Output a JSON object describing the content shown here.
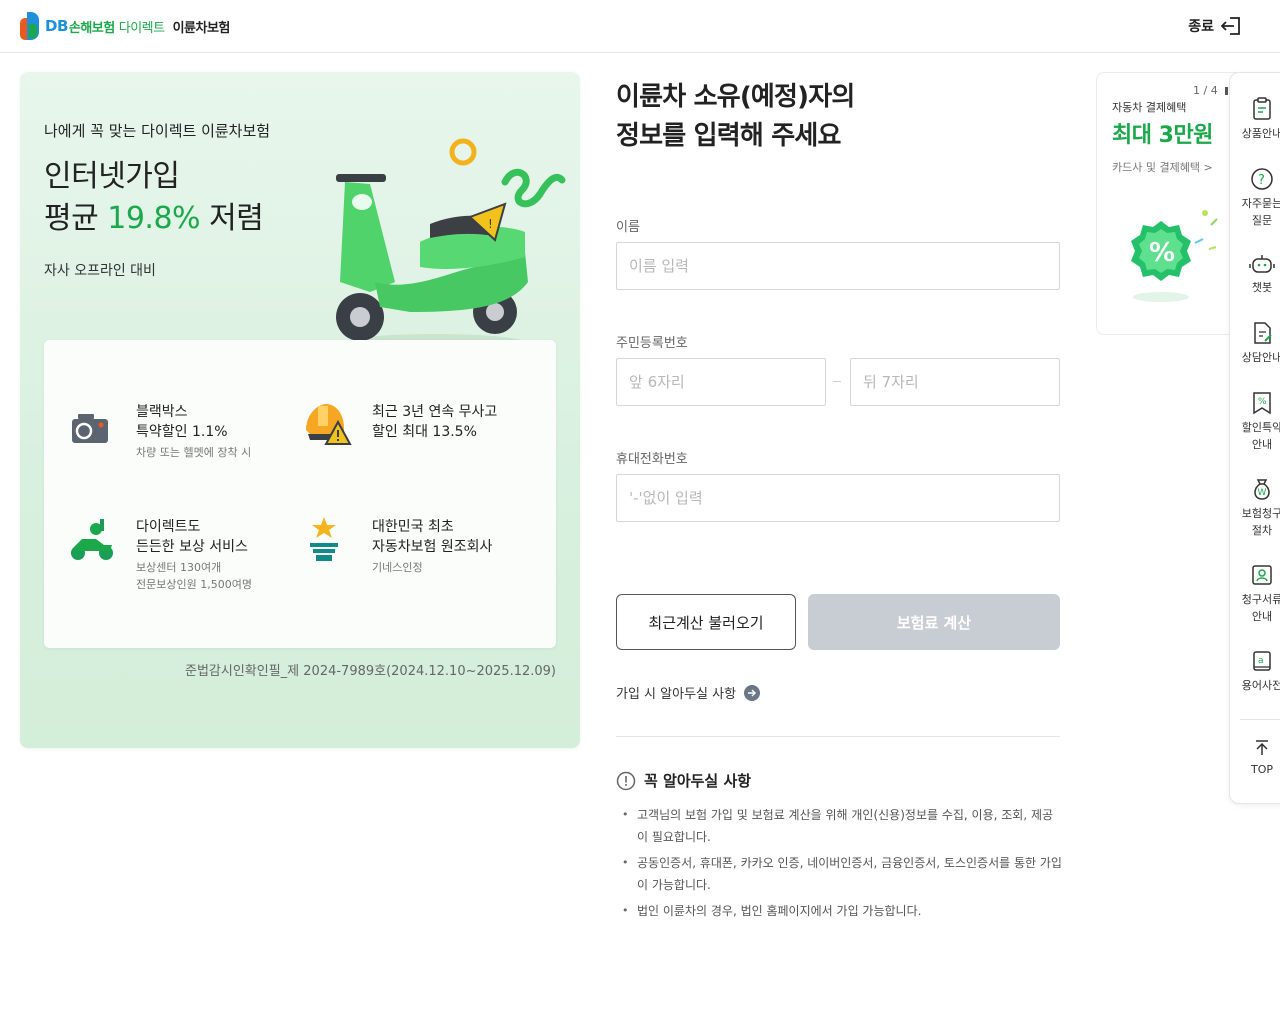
{
  "header": {
    "logo_db": "DB",
    "logo_son": "손해보험",
    "logo_direct": "다이렉트",
    "product": "이륜차보험",
    "exit_label": "종료"
  },
  "promo": {
    "subtitle": "나에게 꼭 맞는 다이렉트 이륜차보험",
    "title_line1": "인터넷가입",
    "title_line2_prefix": "평균",
    "title_line2_accent": "19.8%",
    "title_line2_suffix": "저렴",
    "note": "자사 오프라인 대비",
    "features": [
      {
        "title": "블랙박스\n특약할인 1.1%",
        "desc": "차량 또는 헬멧에 장착 시",
        "icon": "blackbox-camera-icon"
      },
      {
        "title": "최근 3년 연속 무사고\n할인 최대 13.5%",
        "desc": "",
        "icon": "helmet-warning-icon"
      },
      {
        "title": "다이렉트도\n든든한 보상 서비스",
        "desc": "보상센터 130여개\n전문보상인원 1,500여명",
        "icon": "scooter-service-icon"
      },
      {
        "title": "대한민국 최초\n자동차보험 원조회사",
        "desc": "기네스인정",
        "icon": "star-trophy-icon"
      }
    ],
    "footnote": "준법감시인확인필_제 2024-7989호(2024.12.10~2025.12.09)"
  },
  "form": {
    "title_line1": "이륜차 소유(예정)자의",
    "title_line2": "정보를 입력해 주세요",
    "name_label": "이름",
    "name_placeholder": "이름 입력",
    "rrn_label": "주민등록번호",
    "rrn_front_placeholder": "앞 6자리",
    "rrn_back_placeholder": "뒤 7자리",
    "phone_label": "휴대전화번호",
    "phone_placeholder": "'-'없이 입력",
    "recent_button": "최근계산 불러오기",
    "calc_button": "보험료 계산",
    "guide_link": "가입 시 알아두실 사항"
  },
  "notice": {
    "title": "꼭 알아두실 사항",
    "items": [
      "고객님의 보험 가입 및 보험료 계산을 위해 개인(신용)정보를 수집, 이용, 조회, 제공이 필요합니다.",
      "공동인증서, 휴대폰, 카카오 인증, 네이버인증서, 금융인증서, 토스인증서를 통한 가입이 가능합니다.",
      "법인 이륜차의 경우, 법인 홈페이지에서 가입 가능합니다."
    ]
  },
  "ad": {
    "page": "1 / 4",
    "category": "자동차 결제혜택",
    "headline": "최대 3만원",
    "link": "카드사 및 결제혜택 >"
  },
  "quick_menu": [
    {
      "label": "상품안내",
      "icon": "product-doc-icon"
    },
    {
      "label": "자주묻는\n질문",
      "icon": "question-icon"
    },
    {
      "label": "챗봇",
      "icon": "chatbot-icon"
    },
    {
      "label": "상담안내",
      "icon": "consult-doc-icon"
    },
    {
      "label": "할인특약\n안내",
      "icon": "discount-doc-icon"
    },
    {
      "label": "보험청구\n절차",
      "icon": "money-bag-icon"
    },
    {
      "label": "청구서류\n안내",
      "icon": "claim-doc-icon"
    },
    {
      "label": "용어사전",
      "icon": "dictionary-icon"
    },
    {
      "label": "TOP",
      "icon": "arrow-top-icon"
    }
  ]
}
